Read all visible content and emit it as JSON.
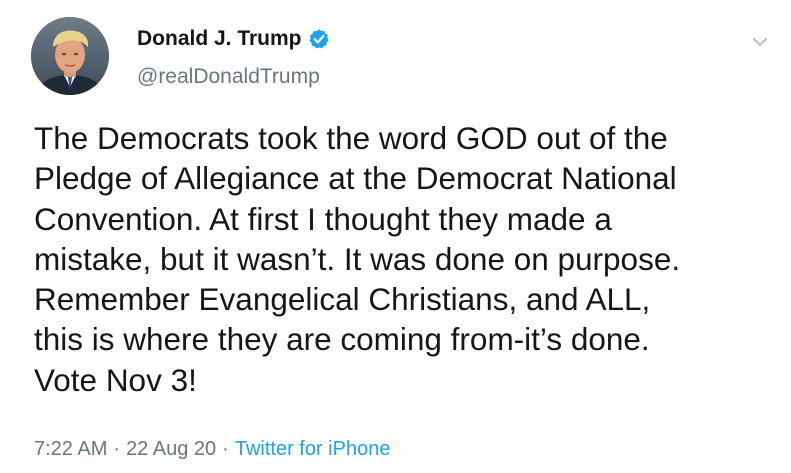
{
  "author": {
    "display_name": "Donald J. Trump",
    "handle": "@realDonaldTrump",
    "verified": true,
    "avatar_icon": "profile-photo"
  },
  "tweet": {
    "lines": [
      "The Democrats took the word GOD out of the",
      "Pledge of Allegiance at the Democrat National",
      "Convention. At first I thought they made a",
      "mistake, but it wasn’t. It was done on purpose.",
      "Remember Evangelical Christians, and ALL,",
      "this is where they are coming from-it’s done.",
      "Vote Nov 3!"
    ]
  },
  "meta": {
    "time": "7:22 AM",
    "separator": "·",
    "date": "22 Aug 20",
    "source": "Twitter for iPhone"
  },
  "colors": {
    "text": "#14171a",
    "secondary": "#657786",
    "link": "#1da1f2",
    "verified": "#1da1f2",
    "caret": "#aab8c2"
  },
  "icons": {
    "verified": "verified-badge-icon",
    "menu": "chevron-down-icon"
  }
}
